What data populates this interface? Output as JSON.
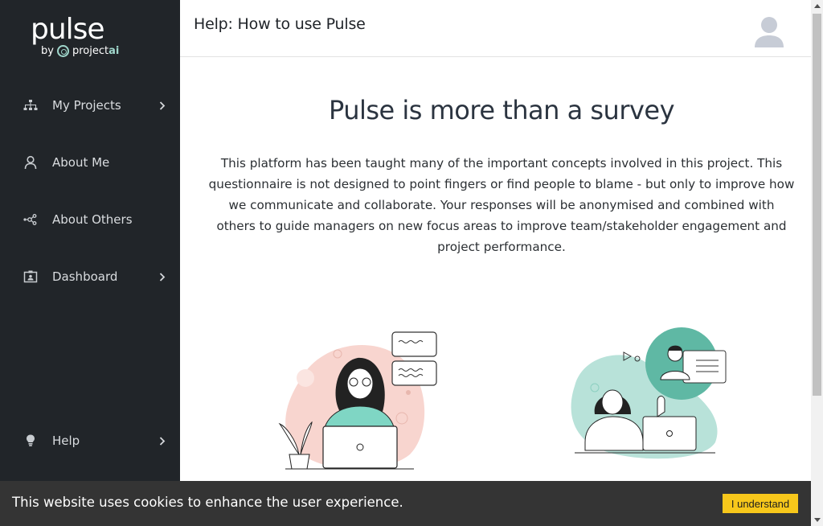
{
  "brand": {
    "name": "pulse",
    "by": "by",
    "company": "project",
    "company_suffix": "ai",
    "accent": "#9fd6cb"
  },
  "sidebar": {
    "background": "#212529",
    "items": [
      {
        "label": "My Projects",
        "icon": "sitemap-icon",
        "has_chevron": true
      },
      {
        "label": "About Me",
        "icon": "user-icon",
        "has_chevron": false
      },
      {
        "label": "About Others",
        "icon": "network-icon",
        "has_chevron": false
      },
      {
        "label": "Dashboard",
        "icon": "id-badge-icon",
        "has_chevron": true
      },
      {
        "label": "Help",
        "icon": "lightbulb-icon",
        "has_chevron": true
      }
    ]
  },
  "header": {
    "title": "Help: How to use Pulse",
    "avatar_icon": "user-avatar-icon"
  },
  "main": {
    "heading": "Pulse is more than a survey",
    "intro": "This platform has been taught many of the important concepts involved in this project. This questionnaire is not designed to point fingers or find people to blame - but only to improve how we communicate and collaborate. Your responses will be anonymised and combined with others to guide managers on new focus areas to improve team/stakeholder engagement and project performance."
  },
  "cookie": {
    "message": "This website uses cookies to enhance the user experience.",
    "button": "I understand",
    "button_color": "#f7c71b"
  }
}
